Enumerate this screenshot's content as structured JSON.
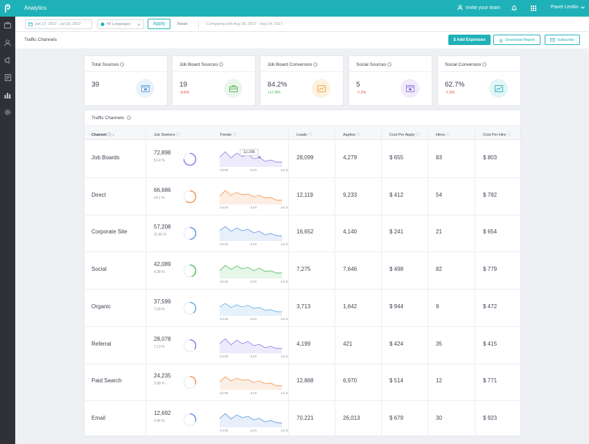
{
  "topbar": {
    "title": "Analytics",
    "invite_label": "Invite your team",
    "user_name": "Pavel Levitin"
  },
  "filters": {
    "date_range": "Jun 17, 2017 - Jul 16, 2017",
    "language": "All Languages",
    "apply_label": "Apply",
    "reset_label": "Reset",
    "compare_text": "Comparing with Aug 26, 2017 - Sep 24, 2017"
  },
  "header": {
    "title": "Traffic Channels",
    "add_expenses_label": "$ Add Expenses",
    "download_label": "Download Report",
    "subscribe_label": "Subscribe"
  },
  "cards": [
    {
      "label": "Total Sources",
      "value": "39",
      "change": "",
      "icon": "browser-icon",
      "color": "#5b9bd5",
      "bg": "#eaf3fb"
    },
    {
      "label": "Job Board Sources",
      "value": "19",
      "change": "-9.6%",
      "change_color": "#e5483f",
      "icon": "briefcase-icon",
      "color": "#4caf50",
      "bg": "#eaf6ec"
    },
    {
      "label": "Job Board Conversion",
      "value": "84.2%",
      "change": "+17.8%",
      "change_color": "#3eb15a",
      "icon": "chart-icon",
      "color": "#f2a53a",
      "bg": "#fdf1df"
    },
    {
      "label": "Social Sources",
      "value": "5",
      "change": "-7.2%",
      "change_color": "#e5483f",
      "icon": "browser-icon",
      "color": "#8e74d6",
      "bg": "#efebfa"
    },
    {
      "label": "Social Conversion",
      "value": "62.7%",
      "change": "-7.2%",
      "change_color": "#e5483f",
      "icon": "chart-icon",
      "color": "#1fb1b8",
      "bg": "#e3f5f6"
    }
  ],
  "table": {
    "title": "Traffic Channels",
    "columns": [
      "Channel",
      "Job Seekers",
      "Trends",
      "Leads",
      "Applies",
      "Cost Per Apply",
      "Hires",
      "Cost Per Hire"
    ],
    "tick_labels": [
      "Jul 05",
      "Jul 8",
      "Jul 10"
    ],
    "tooltip": "12,295",
    "rows": [
      {
        "channel": "Job Boards",
        "seekers": "72,898",
        "pct": "51.4 %",
        "share": 0.75,
        "color": "#8e86e8",
        "fill": "#edeafb",
        "leads": "28,099",
        "applies": "4,279",
        "cpa": "$ 655",
        "hires": "83",
        "cph": "$ 803",
        "trend": [
          12,
          20,
          11,
          18,
          13,
          16,
          10,
          12,
          6,
          8,
          5,
          5
        ]
      },
      {
        "channel": "Direct",
        "seekers": "66,686",
        "pct": "14.1 %",
        "share": 0.6,
        "color": "#f29a5a",
        "fill": "#fdeee3",
        "leads": "12,119",
        "applies": "9,233",
        "cpa": "$ 412",
        "hires": "54",
        "cph": "$ 782",
        "trend": [
          10,
          18,
          11,
          15,
          12,
          13,
          9,
          11,
          7,
          8,
          4,
          4
        ]
      },
      {
        "channel": "Corporate Site",
        "seekers": "57,208",
        "pct": "11.65 %",
        "share": 0.5,
        "color": "#6a9be5",
        "fill": "#e7effb",
        "leads": "16,652",
        "applies": "4,140",
        "cpa": "$ 241",
        "hires": "21",
        "cph": "$ 654",
        "trend": [
          13,
          19,
          12,
          17,
          13,
          15,
          10,
          12,
          7,
          9,
          6,
          5
        ]
      },
      {
        "channel": "Social",
        "seekers": "42,089",
        "pct": "6.38 %",
        "share": 0.45,
        "color": "#5cc26a",
        "fill": "#e6f6e9",
        "leads": "7,275",
        "applies": "7,646",
        "cpa": "$ 498",
        "hires": "82",
        "cph": "$ 779",
        "trend": [
          9,
          17,
          11,
          16,
          12,
          14,
          9,
          13,
          8,
          9,
          6,
          6
        ]
      },
      {
        "channel": "Organic",
        "seekers": "37,599",
        "pct": "7.29 %",
        "share": 0.4,
        "color": "#6cb3ea",
        "fill": "#e6f2fb",
        "leads": "3,713",
        "applies": "1,642",
        "cpa": "$ 944",
        "hires": "9",
        "cph": "$ 472",
        "trend": [
          11,
          16,
          10,
          14,
          11,
          13,
          9,
          10,
          6,
          7,
          4,
          4
        ]
      },
      {
        "channel": "Referral",
        "seekers": "28,078",
        "pct": "7.13 %",
        "share": 0.35,
        "color": "#8e86e8",
        "fill": "#edeafb",
        "leads": "4,199",
        "applies": "421",
        "cpa": "$ 424",
        "hires": "35",
        "cph": "$ 415",
        "trend": [
          12,
          19,
          10,
          17,
          12,
          15,
          9,
          11,
          6,
          8,
          5,
          5
        ]
      },
      {
        "channel": "Paid Search",
        "seekers": "24,235",
        "pct": "3.68 %",
        "share": 0.3,
        "color": "#f29a5a",
        "fill": "#fdeee3",
        "leads": "12,868",
        "applies": "6,970",
        "cpa": "$ 514",
        "hires": "12",
        "cph": "$ 771",
        "trend": [
          10,
          17,
          11,
          15,
          12,
          13,
          9,
          11,
          7,
          8,
          4,
          4
        ]
      },
      {
        "channel": "Email",
        "seekers": "12,692",
        "pct": "3.46 %",
        "share": 0.3,
        "color": "#6a9be5",
        "fill": "#e7effb",
        "leads": "70,221",
        "applies": "26,013",
        "cpa": "$ 679",
        "hires": "30",
        "cph": "$ 923",
        "trend": [
          11,
          18,
          10,
          16,
          12,
          14,
          9,
          11,
          6,
          8,
          5,
          4
        ]
      }
    ]
  }
}
